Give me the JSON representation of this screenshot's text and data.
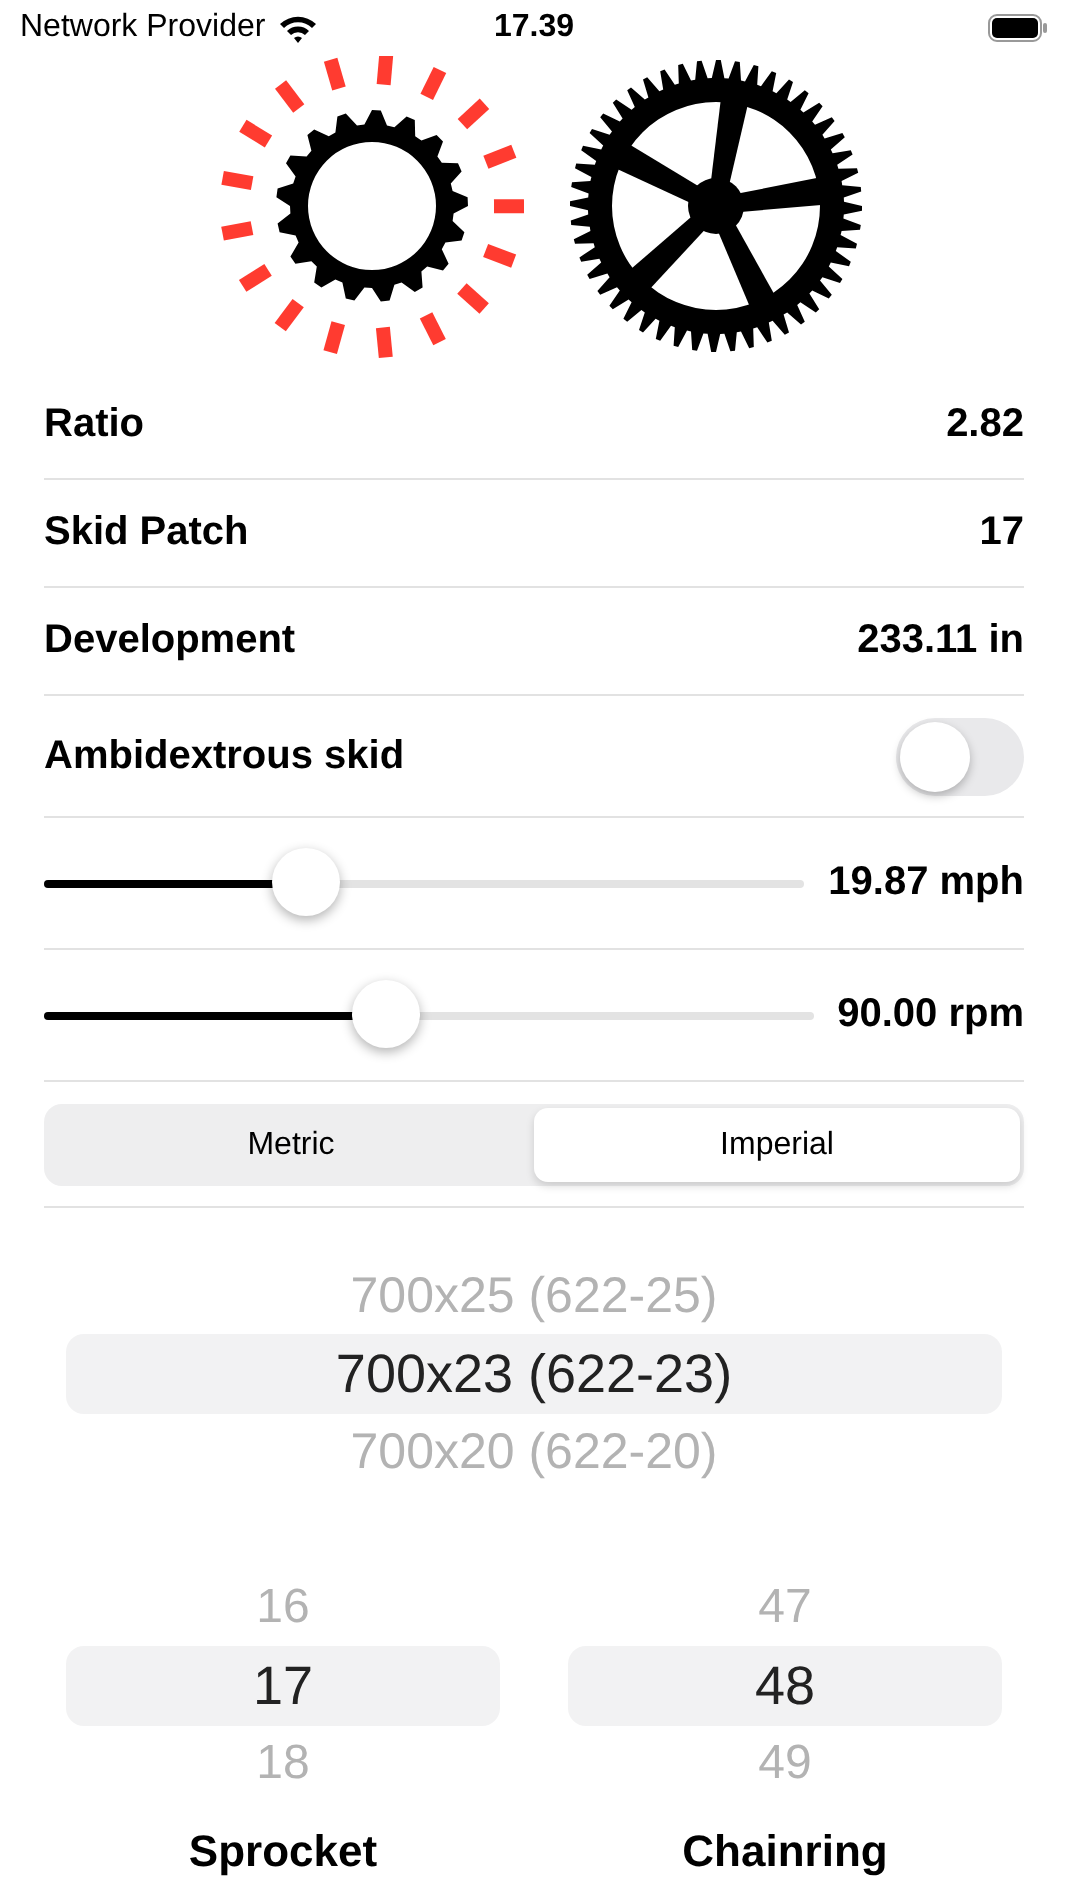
{
  "status_bar": {
    "carrier": "Network Provider",
    "time": "17.39"
  },
  "stats": [
    {
      "label": "Ratio",
      "value": "2.82"
    },
    {
      "label": "Skid Patch",
      "value": "17"
    },
    {
      "label": "Development",
      "value": "233.11 in"
    }
  ],
  "ambidextrous": {
    "label": "Ambidextrous skid",
    "on": false
  },
  "sliders": [
    {
      "level": 0.345,
      "reading": "19.87 mph"
    },
    {
      "level": 0.445,
      "reading": "90.00 rpm"
    }
  ],
  "units": [
    {
      "label": "Metric",
      "selected": false
    },
    {
      "label": "Imperial",
      "selected": true
    }
  ],
  "tire_picker": [
    {
      "label": "700x25 (622-25)",
      "selected": false
    },
    {
      "label": "700x23 (622-23)",
      "selected": true
    },
    {
      "label": "700x20 (622-20)",
      "selected": false
    }
  ],
  "gear_pickers": [
    {
      "label": "Sprocket",
      "items": [
        {
          "label": "16",
          "selected": false
        },
        {
          "label": "17",
          "selected": true
        },
        {
          "label": "18",
          "selected": false
        }
      ]
    },
    {
      "label": "Chainring",
      "items": [
        {
          "label": "47",
          "selected": false
        },
        {
          "label": "48",
          "selected": true
        },
        {
          "label": "49",
          "selected": false
        }
      ]
    }
  ]
}
